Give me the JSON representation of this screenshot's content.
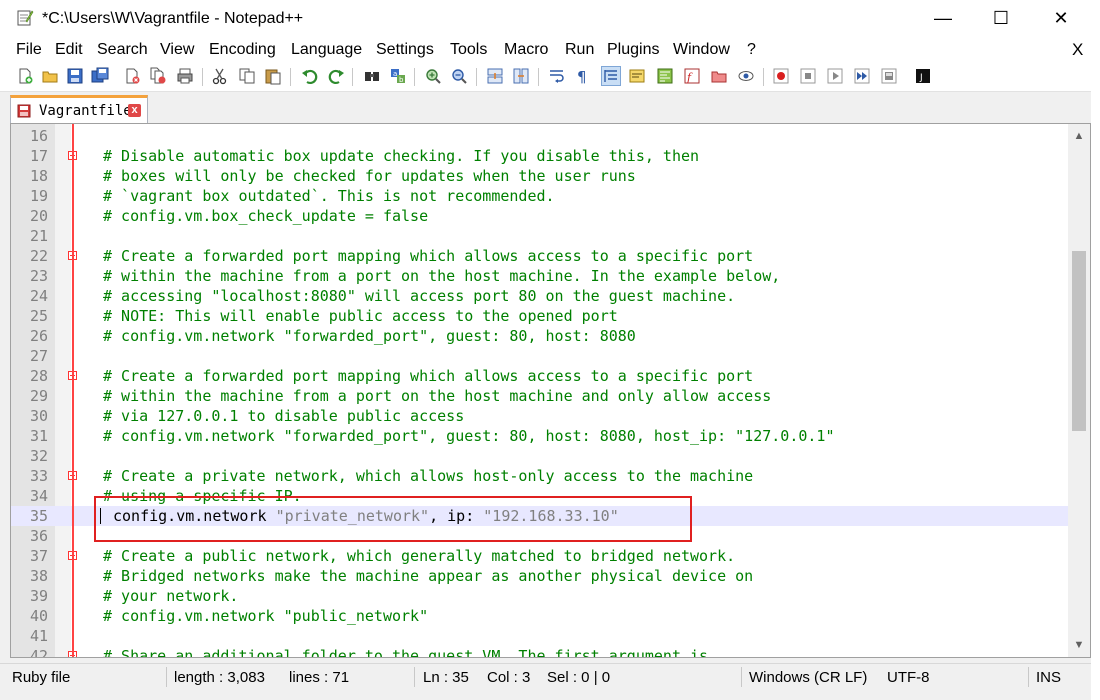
{
  "window": {
    "title": "*C:\\Users\\W\\Vagrantfile - Notepad++",
    "minimize_glyph": "—",
    "maximize_glyph": "☐",
    "close_glyph": "✕"
  },
  "menu": {
    "items": [
      "File",
      "Edit",
      "Search",
      "View",
      "Encoding",
      "Language",
      "Settings",
      "Tools",
      "Macro",
      "Run",
      "Plugins",
      "Window",
      "?"
    ],
    "close_doc": "X"
  },
  "toolbar": {
    "buttons": [
      "new-file-icon",
      "open-file-icon",
      "save-icon",
      "save-all-icon",
      "close-icon",
      "close-all-icon",
      "print-icon",
      "cut-icon",
      "copy-icon",
      "paste-icon",
      "undo-icon",
      "redo-icon",
      "find-icon",
      "replace-icon",
      "zoom-in-icon",
      "zoom-out-icon",
      "sync-vertical-icon",
      "sync-horizontal-icon",
      "word-wrap-icon",
      "show-all-chars-icon",
      "indent-guide-icon",
      "user-lang-icon",
      "doc-map-icon",
      "function-list-icon",
      "folder-workspace-icon",
      "monitor-icon",
      "record-macro-icon",
      "stop-record-icon",
      "play-macro-icon",
      "play-multiple-icon",
      "save-macro-icon",
      "plugin-j-icon"
    ]
  },
  "tab": {
    "label": "Vagrantfile",
    "close_glyph": "x"
  },
  "editor": {
    "lines": [
      {
        "n": "16",
        "text": "",
        "type": "comment",
        "fold": false
      },
      {
        "n": "17",
        "text": "# Disable automatic box update checking. If you disable this, then",
        "type": "comment",
        "fold": true
      },
      {
        "n": "18",
        "text": "# boxes will only be checked for updates when the user runs",
        "type": "comment",
        "fold": false
      },
      {
        "n": "19",
        "text": "# `vagrant box outdated`. This is not recommended.",
        "type": "comment",
        "fold": false
      },
      {
        "n": "20",
        "text": "# config.vm.box_check_update = false",
        "type": "comment",
        "fold": false
      },
      {
        "n": "21",
        "text": "",
        "type": "comment",
        "fold": false
      },
      {
        "n": "22",
        "text": "# Create a forwarded port mapping which allows access to a specific port",
        "type": "comment",
        "fold": true
      },
      {
        "n": "23",
        "text": "# within the machine from a port on the host machine. In the example below,",
        "type": "comment",
        "fold": false
      },
      {
        "n": "24",
        "text": "# accessing \"localhost:8080\" will access port 80 on the guest machine.",
        "type": "comment",
        "fold": false
      },
      {
        "n": "25",
        "text": "# NOTE: This will enable public access to the opened port",
        "type": "comment",
        "fold": false
      },
      {
        "n": "26",
        "text": "# config.vm.network \"forwarded_port\", guest: 80, host: 8080",
        "type": "comment",
        "fold": false
      },
      {
        "n": "27",
        "text": "",
        "type": "comment",
        "fold": false
      },
      {
        "n": "28",
        "text": "# Create a forwarded port mapping which allows access to a specific port",
        "type": "comment",
        "fold": true
      },
      {
        "n": "29",
        "text": "# within the machine from a port on the host machine and only allow access",
        "type": "comment",
        "fold": false
      },
      {
        "n": "30",
        "text": "# via 127.0.0.1 to disable public access",
        "type": "comment",
        "fold": false
      },
      {
        "n": "31",
        "text": "# config.vm.network \"forwarded_port\", guest: 80, host: 8080, host_ip: \"127.0.0.1\"",
        "type": "comment",
        "fold": false
      },
      {
        "n": "32",
        "text": "",
        "type": "comment",
        "fold": false
      },
      {
        "n": "33",
        "text": "# Create a private network, which allows host-only access to the machine",
        "type": "comment",
        "fold": true
      },
      {
        "n": "34",
        "text": "# using a specific IP.",
        "type": "comment",
        "fold": false
      },
      {
        "n": "35",
        "text": "",
        "type": "current",
        "fold": false
      },
      {
        "n": "36",
        "text": "",
        "type": "comment",
        "fold": false
      },
      {
        "n": "37",
        "text": "# Create a public network, which generally matched to bridged network.",
        "type": "comment",
        "fold": true
      },
      {
        "n": "38",
        "text": "# Bridged networks make the machine appear as another physical device on",
        "type": "comment",
        "fold": false
      },
      {
        "n": "39",
        "text": "# your network.",
        "type": "comment",
        "fold": false
      },
      {
        "n": "40",
        "text": "# config.vm.network \"public_network\"",
        "type": "comment",
        "fold": false
      },
      {
        "n": "41",
        "text": "",
        "type": "comment",
        "fold": false
      },
      {
        "n": "42",
        "text": "# Share an additional folder to the guest VM. The first argument is",
        "type": "comment",
        "fold": true
      }
    ],
    "current_line": {
      "prefix": "config.vm.network ",
      "string": "\"private_network\"",
      "middle": ", ip: ",
      "ip": "\"192.168.33.10\""
    }
  },
  "status": {
    "file_type": "Ruby file",
    "length": "length : 3,083",
    "lines": "lines : 71",
    "ln": "Ln : 35",
    "col": "Col : 3",
    "sel": "Sel : 0 | 0",
    "eol": "Windows (CR LF)",
    "encoding": "UTF-8",
    "mode": "INS"
  }
}
